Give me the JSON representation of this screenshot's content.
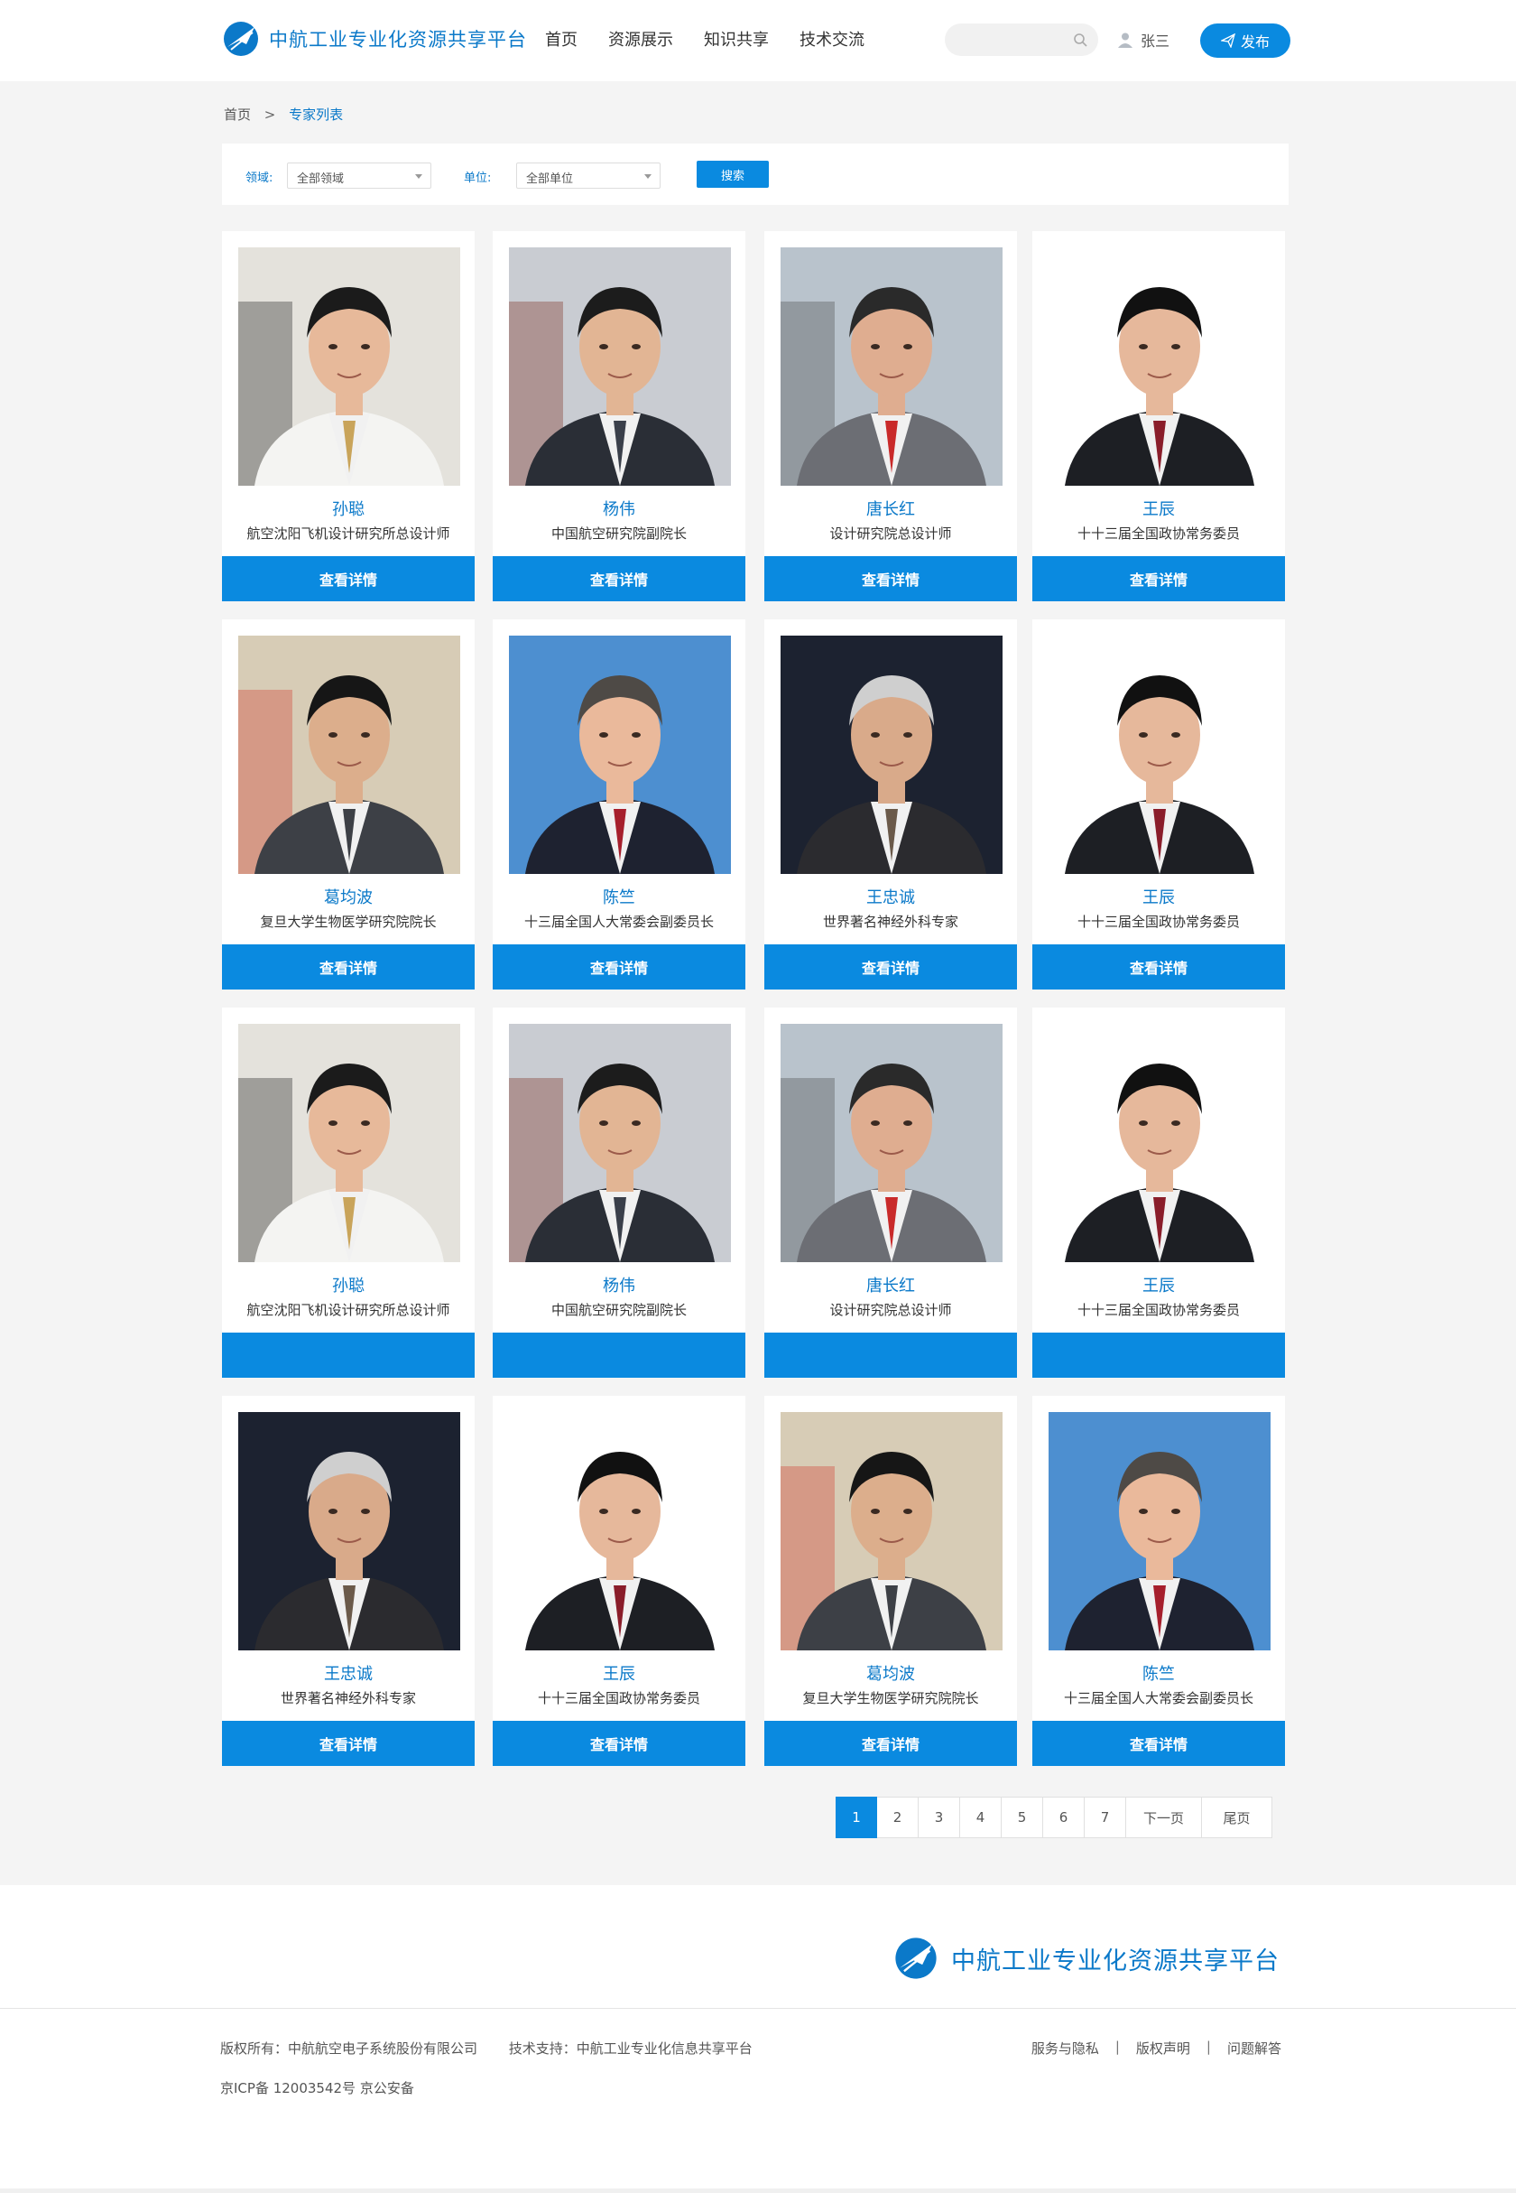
{
  "header": {
    "brand": "中航工业专业化资源共享平台",
    "nav": [
      "首页",
      "资源展示",
      "知识共享",
      "技术交流"
    ],
    "search_placeholder": "",
    "user_name": "张三",
    "publish_label": "发布"
  },
  "breadcrumb": {
    "home": "首页",
    "separator": ">",
    "current": "专家列表"
  },
  "filter": {
    "field_label": "领域:",
    "field_value": "全部领域",
    "unit_label": "单位:",
    "unit_value": "全部单位",
    "search_label": "搜索"
  },
  "experts": [
    {
      "name": "孙聪",
      "title": "航空沈阳飞机设计研究所总设计师",
      "button": "查看详情",
      "photo": "p1"
    },
    {
      "name": "杨伟",
      "title": "中国航空研究院副院长",
      "button": "查看详情",
      "photo": "p2"
    },
    {
      "name": "唐长红",
      "title": "设计研究院总设计师",
      "button": "查看详情",
      "photo": "p3"
    },
    {
      "name": "王辰",
      "title": "十十三届全国政协常务委员",
      "button": "查看详情",
      "photo": "p4"
    },
    {
      "name": "葛均波",
      "title": "复旦大学生物医学研究院院长",
      "button": "查看详情",
      "photo": "p5"
    },
    {
      "name": "陈竺",
      "title": "十三届全国人大常委会副委员长",
      "button": "查看详情",
      "photo": "p6"
    },
    {
      "name": "王忠诚",
      "title": "世界著名神经外科专家",
      "button": "查看详情",
      "photo": "p7"
    },
    {
      "name": "王辰",
      "title": "十十三届全国政协常务委员",
      "button": "查看详情",
      "photo": "p4"
    },
    {
      "name": "孙聪",
      "title": "航空沈阳飞机设计研究所总设计师",
      "button": "",
      "photo": "p1"
    },
    {
      "name": "杨伟",
      "title": "中国航空研究院副院长",
      "button": "",
      "photo": "p2"
    },
    {
      "name": "唐长红",
      "title": "设计研究院总设计师",
      "button": "",
      "photo": "p3"
    },
    {
      "name": "王辰",
      "title": "十十三届全国政协常务委员",
      "button": "",
      "photo": "p4"
    },
    {
      "name": "王忠诚",
      "title": "世界著名神经外科专家",
      "button": "查看详情",
      "photo": "p7"
    },
    {
      "name": "王辰",
      "title": "十十三届全国政协常务委员",
      "button": "查看详情",
      "photo": "p4"
    },
    {
      "name": "葛均波",
      "title": "复旦大学生物医学研究院院长",
      "button": "查看详情",
      "photo": "p5"
    },
    {
      "name": "陈竺",
      "title": "十三届全国人大常委会副委员长",
      "button": "查看详情",
      "photo": "p6"
    }
  ],
  "pagination": {
    "pages": [
      "1",
      "2",
      "3",
      "4",
      "5",
      "6",
      "7"
    ],
    "current": "1",
    "next": "下一页",
    "last": "尾页"
  },
  "footer": {
    "brand": "中航工业专业化资源共享平台",
    "copyright": "版权所有：中航航空电子系统股份有限公司",
    "support": "技术支持：中航工业专业化信息共享平台",
    "icp": "京ICP备 12003542号 京公安备",
    "links": [
      "服务与隐私",
      "版权声明",
      "问题解答"
    ]
  },
  "colors": {
    "accent": "#0a8ae0",
    "brand_text": "#0b79c9",
    "page_bg": "#f4f4f4"
  }
}
